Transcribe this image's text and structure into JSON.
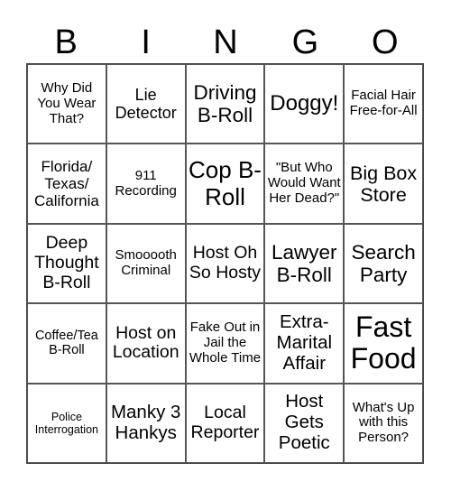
{
  "header": [
    "B",
    "I",
    "N",
    "G",
    "O"
  ],
  "cells": [
    "Why Did You Wear That?",
    "Lie Detector",
    "Driving B-Roll",
    "Doggy!",
    "Facial Hair Free-for-All",
    "Florida/ Texas/ California",
    "911 Recording",
    "Cop B-Roll",
    "\"But Who Would Want Her Dead?\"",
    "Big Box Store",
    "Deep Thought B-Roll",
    "Smooooth Criminal",
    "Host Oh So Hosty",
    "Lawyer B-Roll",
    "Search Party",
    "Coffee/Tea B-Roll",
    "Host on Location",
    "Fake Out in Jail the Whole Time",
    "Extra-Marital Affair",
    "Fast Food",
    "Police Interrogation",
    "Manky 3 Hankys",
    "Local Reporter",
    "Host Gets Poetic",
    "What's Up with this Person?"
  ]
}
